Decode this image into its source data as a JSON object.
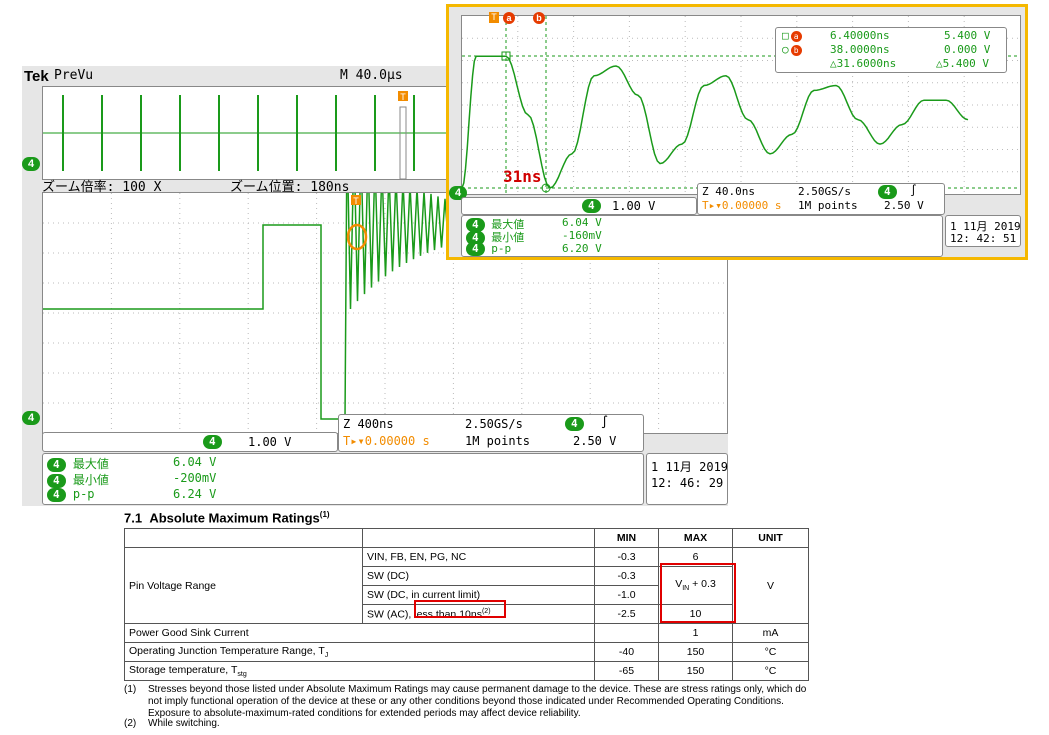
{
  "main_scope": {
    "brand": "Tek",
    "mode": "PreVu",
    "timebase": "M 40.0µs",
    "zoom_factor_label": "ズーム倍率: 100 X",
    "zoom_position_label": "ズーム位置: 180ns",
    "channel_marker": "4",
    "ch_scale": "1.00 V",
    "zoom_settings": {
      "zoom": "Z 400ns",
      "sample_rate": "2.50GS/s",
      "trigger_offset": "0.00000 s",
      "record": "1M points",
      "trigger_level": "2.50 V"
    },
    "measurements": [
      {
        "label": "最大値",
        "value": "6.04 V"
      },
      {
        "label": "最小値",
        "value": "-200mV"
      },
      {
        "label": "p-p",
        "value": "6.24 V"
      }
    ],
    "date": "1 11月  2019",
    "time": "12: 46: 29"
  },
  "inset_scope": {
    "cursor_a_label": "a",
    "cursor_b_label": "b",
    "cursor_readout": [
      {
        "time": "6.40000ns",
        "volt": "5.400 V"
      },
      {
        "time": "38.0000ns",
        "volt": "0.000 V"
      },
      {
        "time": "△31.6000ns",
        "volt": "△5.400 V"
      }
    ],
    "annotation": "31ns",
    "ch_scale": "1.00 V",
    "zoom_settings": {
      "zoom": "Z 40.0ns",
      "sample_rate": "2.50GS/s",
      "trigger_offset": "0.00000 s",
      "record": "1M points",
      "trigger_level": "2.50 V"
    },
    "measurements": [
      {
        "label": "最大値",
        "value": "6.04 V"
      },
      {
        "label": "最小値",
        "value": "-160mV"
      },
      {
        "label": "p-p",
        "value": "6.20 V"
      }
    ],
    "date": "1 11月  2019",
    "time": "12: 42: 51"
  },
  "table": {
    "title_prefix": "7.1",
    "title": "Absolute Maximum Ratings",
    "title_note": "(1)",
    "headers": [
      "MIN",
      "MAX",
      "UNIT"
    ],
    "pin_voltage_label": "Pin Voltage Range",
    "rows": [
      {
        "param": "VIN, FB, EN, PG, NC",
        "min": "-0.3",
        "max": "6"
      },
      {
        "param": "SW (DC)",
        "min": "-0.3"
      },
      {
        "param": "SW (DC, in current limit)",
        "min": "-1.0"
      },
      {
        "param_a": "SW (AC), ",
        "param_b": "less than 10ns",
        "param_note": "(2)",
        "min": "-2.5",
        "max": "10"
      }
    ],
    "vin_max_a": "V",
    "vin_max_sub": "IN",
    "vin_max_b": " + 0.3",
    "pin_unit": "V",
    "pg_label": "Power Good Sink Current",
    "pg_max": "1",
    "pg_unit": "mA",
    "tj_label_a": "Operating Junction Temperature Range, T",
    "tj_sub": "J",
    "tj_min": "-40",
    "tj_max": "150",
    "tj_unit": "°C",
    "ts_label_a": "Storage temperature, T",
    "ts_sub": "stg",
    "ts_min": "-65",
    "ts_max": "150",
    "ts_unit": "°C"
  },
  "notes": {
    "n1_num": "(1)",
    "n1": "Stresses beyond those listed under Absolute Maximum Ratings may cause permanent damage to the device. These are stress ratings only, which do not imply functional operation of the device at these or any other conditions beyond those indicated under Recommended Operating Conditions. Exposure to absolute-maximum-rated conditions for extended periods may affect device reliability.",
    "n2_num": "(2)",
    "n2": "While switching."
  },
  "chart_data": [
    {
      "type": "line",
      "series": [
        {
          "values_note": "",
          "x": [
            0,
            1,
            2,
            3,
            4,
            5,
            6,
            7,
            8,
            9,
            10,
            11,
            12,
            13,
            14,
            15,
            16,
            17,
            18,
            19,
            20
          ],
          "y": [
            0,
            0,
            0,
            0,
            0,
            2.8,
            2.8,
            2.8,
            -0.2,
            5.8,
            -0.2,
            4.8,
            0.6,
            3.9,
            1.0,
            3.4,
            1.3,
            3.0,
            1.5,
            2.8,
            1.6
          ]
        }
      ]
    },
    {
      "type": "line",
      "series": [
        {
          "x": [
            0,
            6.4,
            10,
            20,
            30,
            40,
            50,
            60,
            70,
            80,
            90,
            100,
            110,
            120,
            130,
            140,
            150,
            160,
            170,
            180,
            190,
            200,
            210,
            220,
            230
          ],
          "y": [
            0,
            5.4,
            5.4,
            5.4,
            3.0,
            0,
            1.4,
            4.6,
            5.0,
            3.8,
            1.0,
            1.8,
            4.2,
            4.6,
            2.8,
            1.4,
            2.2,
            4.0,
            4.2,
            2.8,
            1.8,
            2.6,
            3.6,
            3.6,
            2.8
          ]
        }
      ]
    }
  ]
}
